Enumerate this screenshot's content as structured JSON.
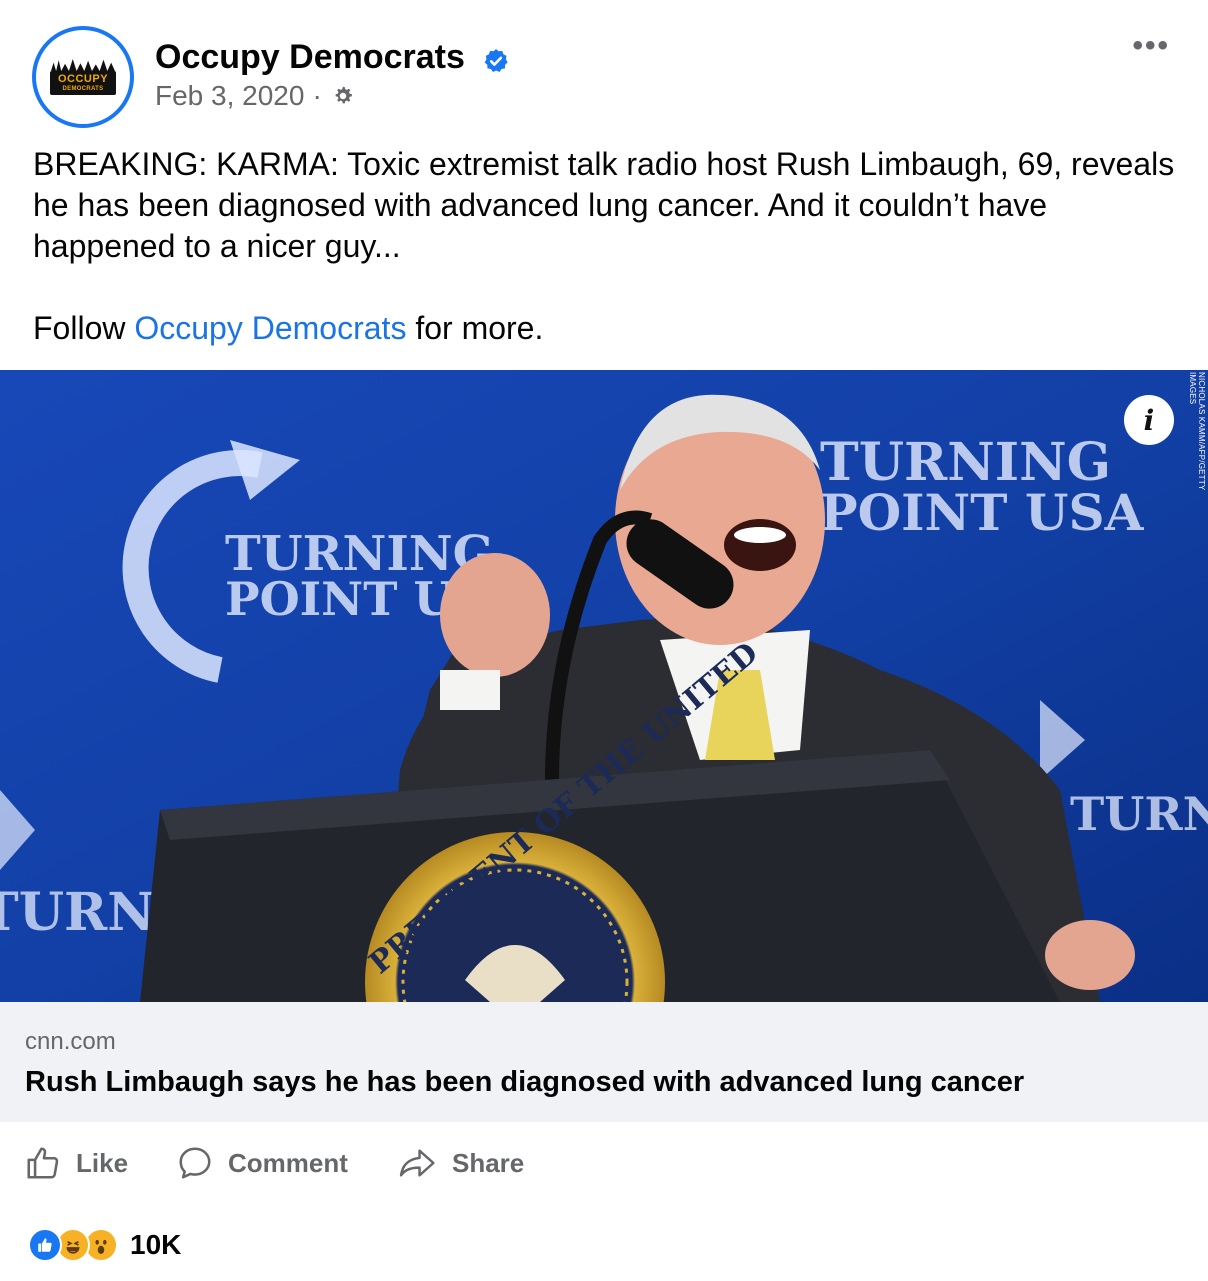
{
  "page": {
    "name": "Occupy Democrats",
    "logo_line1": "OCCUPY",
    "logo_line2": "DEMOCRATS",
    "date": "Feb 3, 2020",
    "date_separator": "·",
    "audience_icon": "globe-gear-icon",
    "more_label": "•••"
  },
  "post": {
    "text": "BREAKING: KARMA: Toxic extremist talk radio host Rush Limbaugh, 69, reveals he has been diagnosed with advanced lung cancer. And it couldn’t have happened to a nicer guy...",
    "follow_prefix": "Follow ",
    "follow_link": "Occupy Democrats",
    "follow_suffix": " for more."
  },
  "photo": {
    "info_label": "i",
    "credit": "NICHOLAS KAMM/AFP/GETTY IMAGES",
    "backdrop_text_1": "TURNING",
    "backdrop_text_2": "POINT USA",
    "seal_text": "PRESIDENT OF THE UNITED"
  },
  "link_preview": {
    "domain": "cnn.com",
    "headline": "Rush Limbaugh says he has been diagnosed with advanced lung cancer"
  },
  "actions": {
    "like": "Like",
    "comment": "Comment",
    "share": "Share"
  },
  "reactions": {
    "types": [
      "like",
      "haha",
      "wow"
    ],
    "count": "10K"
  },
  "colors": {
    "verified": "#1877f2",
    "link": "#1b74e4",
    "secondary_text": "#65676b",
    "preview_bg": "#f0f2f5"
  }
}
